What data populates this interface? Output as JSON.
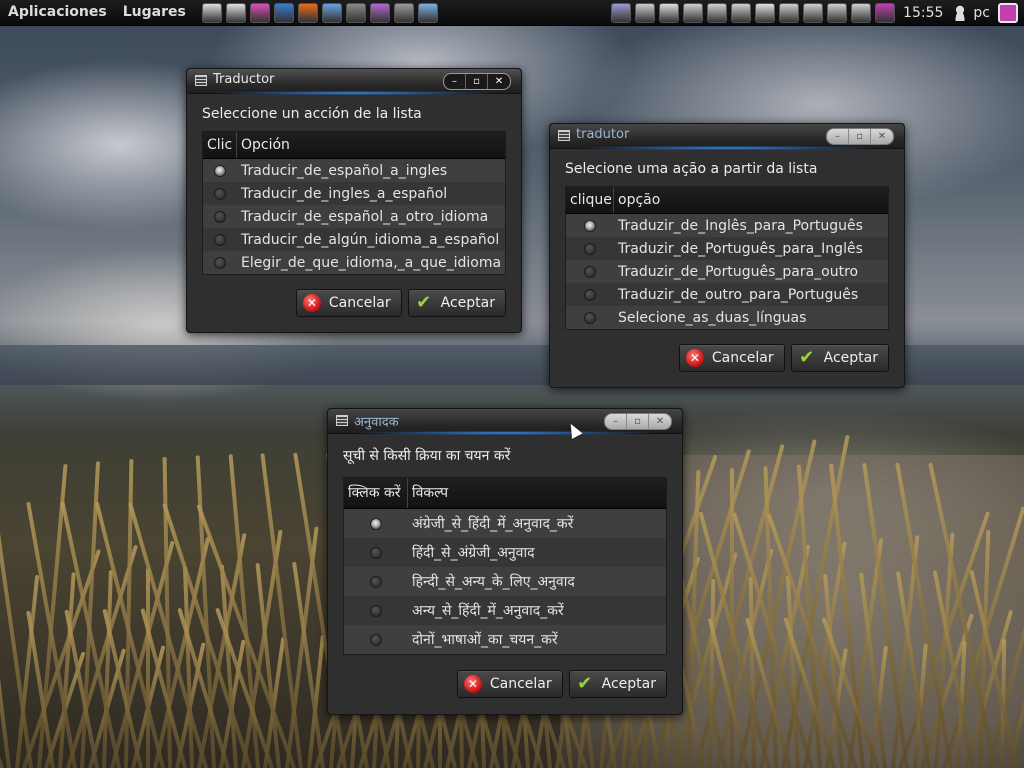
{
  "top_panel": {
    "menus": [
      "Aplicaciones",
      "Lugares"
    ],
    "clock": "15:55",
    "user": "pc",
    "launcher_icons": [
      {
        "name": "text-editor-icon",
        "color": "#dcdcdc"
      },
      {
        "name": "office-doc-icon",
        "color": "#e0e0e0"
      },
      {
        "name": "color-picker-icon",
        "color": "#d94fb5"
      },
      {
        "name": "dictionary-icon",
        "color": "#3c7bd1"
      },
      {
        "name": "firefox-icon",
        "color": "#e86c1c"
      },
      {
        "name": "shield-icon",
        "color": "#6aa1e2"
      },
      {
        "name": "terminal-screen-icon",
        "color": "#8a8a8a"
      },
      {
        "name": "photo-viewer-icon",
        "color": "#b06ad0"
      },
      {
        "name": "media-icon",
        "color": "#9a9a9a"
      },
      {
        "name": "network-share-icon",
        "color": "#7ab0e0"
      }
    ],
    "tray_icons": [
      {
        "name": "mail-notify-icon",
        "color": "#9a9ad0"
      },
      {
        "name": "terminal-icon",
        "color": "#cccccc"
      },
      {
        "name": "folder-icon",
        "color": "#dddddd"
      },
      {
        "name": "archive-icon",
        "color": "#cfcfcf"
      },
      {
        "name": "monitor-color-icon",
        "color": "#d0d0d0"
      },
      {
        "name": "display-icon",
        "color": "#cfcfcf"
      },
      {
        "name": "app-icon",
        "color": "#e0e0e0"
      },
      {
        "name": "mail-icon",
        "color": "#cfcfcf"
      },
      {
        "name": "network-icon",
        "color": "#cfcfcf"
      },
      {
        "name": "volume-icon",
        "color": "#cfcfcf"
      },
      {
        "name": "user-icon",
        "color": "#cfcfcf"
      },
      {
        "name": "session-icon",
        "color": "#c23fb0"
      }
    ]
  },
  "windows": {
    "es": {
      "title": "Traductor",
      "prompt": "Seleccione un acción de la lista",
      "col_click": "Clic",
      "col_option": "Opción",
      "options": [
        {
          "label": "Traducir_de_español_a_ingles",
          "checked": true
        },
        {
          "label": "Traducir_de_ingles_a_español",
          "checked": false
        },
        {
          "label": "Traducir_de_español_a_otro_idioma",
          "checked": false
        },
        {
          "label": "Traducir_de_algún_idioma_a_español",
          "checked": false
        },
        {
          "label": "Elegir_de_que_idioma,_a_que_idioma",
          "checked": false
        }
      ],
      "cancel": "Cancelar",
      "accept": "Aceptar"
    },
    "pt": {
      "title": "tradutor",
      "prompt": "Selecione uma ação a partir da lista",
      "col_click": "clique",
      "col_option": "opção",
      "options": [
        {
          "label": "Traduzir_de_Inglês_para_Português",
          "checked": true
        },
        {
          "label": "Traduzir_de_Português_para_Inglês",
          "checked": false
        },
        {
          "label": "Traduzir_de_Português_para_outro",
          "checked": false
        },
        {
          "label": "Traduzir_de_outro_para_Português",
          "checked": false
        },
        {
          "label": "Selecione_as_duas_línguas",
          "checked": false
        }
      ],
      "cancel": "Cancelar",
      "accept": "Aceptar"
    },
    "hi": {
      "title": "अनुवादक",
      "prompt": "सूची से किसी क्रिया का चयन करें",
      "col_click": "क्लिक करें",
      "col_option": "विकल्प",
      "options": [
        {
          "label": "अंग्रेजी_से_हिंदी_में_अनुवाद_करें",
          "checked": true
        },
        {
          "label": "हिंदी_से_अंग्रेजी_अनुवाद",
          "checked": false
        },
        {
          "label": "हिन्दी_से_अन्य_के_लिए_अनुवाद",
          "checked": false
        },
        {
          "label": "अन्य_से_हिंदी_में_अनुवाद_करें",
          "checked": false
        },
        {
          "label": "दोनों_भाषाओं_का_चयन_करें",
          "checked": false
        }
      ],
      "cancel": "Cancelar",
      "accept": "Aceptar"
    }
  },
  "colors": {
    "title_glow": "#3a8ee6",
    "cancel_red": "#d11a1a",
    "ok_green": "#9ad43a"
  }
}
